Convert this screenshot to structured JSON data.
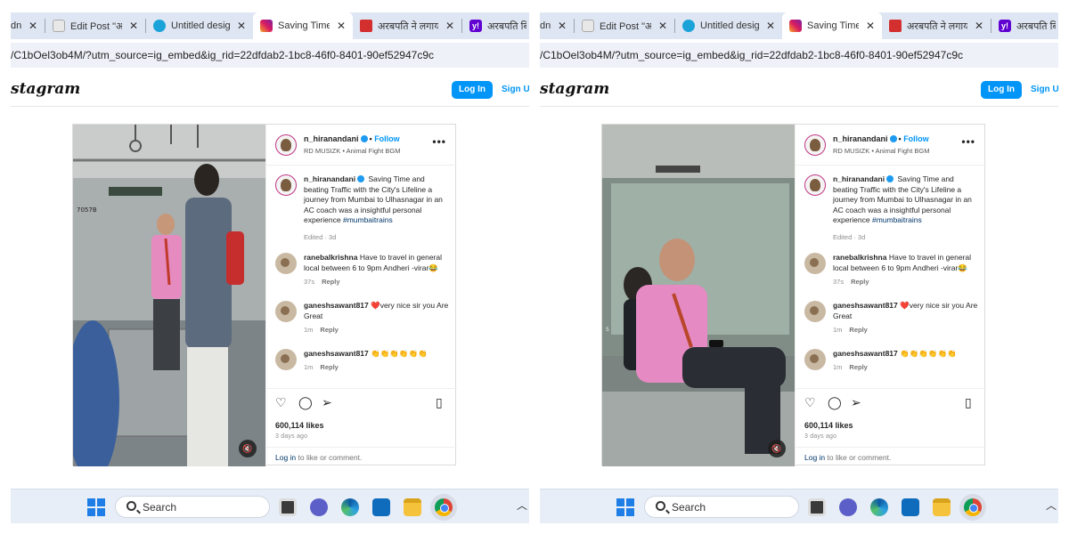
{
  "screens": [
    {
      "id": "left",
      "tabs": [
        {
          "title": "dnc",
          "close": "✕",
          "icon": "doc-icon"
        },
        {
          "title": "Edit Post \"अरबपति",
          "close": "✕",
          "icon": "edit-post-icon"
        },
        {
          "title": "Untitled design",
          "close": "✕",
          "icon": "canva-icon"
        },
        {
          "title": "Saving Time and",
          "close": "✕",
          "icon": "instagram-icon"
        },
        {
          "title": "अरबपति ने लगाया",
          "close": "✕",
          "icon": "news-icon"
        },
        {
          "title": "अरबपति बि",
          "close": "",
          "icon": "yahoo-icon"
        }
      ],
      "url": "/C1bOel3ob4M/?utm_source=ig_embed&ig_rid=22dfdab2-1bc8-46f0-8401-90ef52947c9c",
      "ig": {
        "logo": "stagram",
        "login": "Log In",
        "signup": "Sign Up"
      },
      "post": {
        "username": "n_hiranandani",
        "follow_sep": "•",
        "follow": "Follow",
        "audio": "RD MUSIZK • Animal Fight BGM",
        "more": "•••",
        "caption_user": "n_hiranandani",
        "caption": "Saving Time and beating Traffic with the City's Lifeline a journey from Mumbai to Ulhasnagar in an AC coach was a insightful personal experience",
        "hashtag": "#mumbaitrains",
        "caption_meta": "Edited · 3d",
        "comments": [
          {
            "user": "ranebalkrishna",
            "text": "Have to travel in general local between 6 to 9pm Andheri -virar😂",
            "time": "37s",
            "reply": "Reply"
          },
          {
            "user": "ganeshsawant817",
            "text": "❤️very nice sir you Are Great",
            "time": "1m",
            "reply": "Reply"
          },
          {
            "user": "ganeshsawant817",
            "text": "👏👏👏👏👏👏",
            "time": "1m",
            "reply": "Reply"
          }
        ],
        "likes": "600,114 likes",
        "date": "3 days ago",
        "login_link": "Log in",
        "login_text": " to like or comment.",
        "mute": "🔇"
      },
      "taskbar": {
        "search": "Search"
      }
    },
    {
      "id": "right",
      "tabs": [
        {
          "title": "dnc",
          "close": "✕",
          "icon": "doc-icon"
        },
        {
          "title": "Edit Post \"अरबपति",
          "close": "✕",
          "icon": "edit-post-icon"
        },
        {
          "title": "Untitled design",
          "close": "✕",
          "icon": "canva-icon"
        },
        {
          "title": "Saving Time and",
          "close": "✕",
          "icon": "instagram-icon"
        },
        {
          "title": "अरबपति ने लगाया",
          "close": "✕",
          "icon": "news-icon"
        },
        {
          "title": "अरबपति बि",
          "close": "",
          "icon": "yahoo-icon"
        }
      ],
      "url": "/C1bOel3ob4M/?utm_source=ig_embed&ig_rid=22dfdab2-1bc8-46f0-8401-90ef52947c9c",
      "ig": {
        "logo": "stagram",
        "login": "Log In",
        "signup": "Sign Up"
      },
      "post": {
        "username": "n_hiranandani",
        "follow_sep": "•",
        "follow": "Follow",
        "audio": "RD MUSIZK • Animal Fight BGM",
        "more": "•••",
        "caption_user": "n_hiranandani",
        "caption": "Saving Time and beating Traffic with the City's Lifeline a journey from Mumbai to Ulhasnagar in an AC coach was a insightful personal experience",
        "hashtag": "#mumbaitrains",
        "caption_meta": "Edited · 3d",
        "comments": [
          {
            "user": "ranebalkrishna",
            "text": "Have to travel in general local between 6 to 9pm Andheri -virar😂",
            "time": "37s",
            "reply": "Reply"
          },
          {
            "user": "ganeshsawant817",
            "text": "❤️very nice sir you Are Great",
            "time": "1m",
            "reply": "Reply"
          },
          {
            "user": "ganeshsawant817",
            "text": "👏👏👏👏👏👏",
            "time": "1m",
            "reply": "Reply"
          }
        ],
        "likes": "600,114 likes",
        "date": "3 days ago",
        "login_link": "Log in",
        "login_text": " to like or comment.",
        "mute": "🔇"
      },
      "taskbar": {
        "search": "Search"
      }
    }
  ],
  "colors": {
    "accent": "#0095f6",
    "tabstrip": "#dfe6f3",
    "taskbar": "#e8eef8"
  }
}
